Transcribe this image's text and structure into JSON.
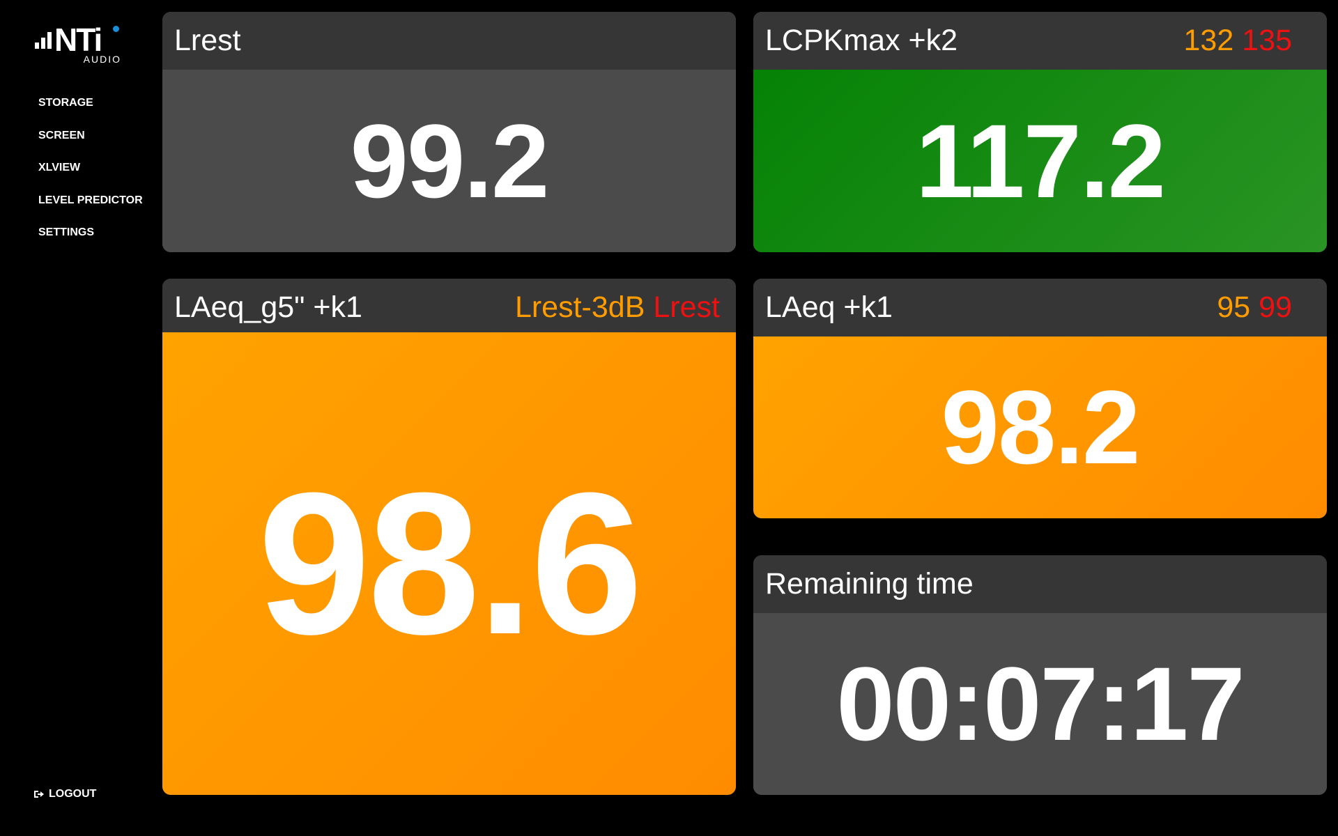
{
  "logo": {
    "main": "NTi",
    "sub": "AUDIO"
  },
  "nav": {
    "items": [
      {
        "label": "STORAGE"
      },
      {
        "label": "SCREEN"
      },
      {
        "label": "XLVIEW"
      },
      {
        "label": "LEVEL PREDICTOR"
      },
      {
        "label": "SETTINGS"
      }
    ],
    "logout_label": "LOGOUT"
  },
  "panels": {
    "lrest": {
      "title": "Lrest",
      "value": "99.2"
    },
    "lcpkmax": {
      "title": "LCPKmax +k2",
      "limit_warn": "132",
      "limit_alarm": "135",
      "value": "117.2"
    },
    "laeq_g5": {
      "title": "LAeq_g5\" +k1",
      "limit_warn": "Lrest-3dB",
      "limit_alarm": "Lrest",
      "value": "98.6"
    },
    "laeq": {
      "title": "LAeq +k1",
      "limit_warn": "95",
      "limit_alarm": "99",
      "value": "98.2"
    },
    "remaining": {
      "title": "Remaining time",
      "value": "00:07:17"
    }
  },
  "colors": {
    "background": "#000000",
    "header": "#363636",
    "neutral": "#4b4b4b",
    "ok_green": "#058205",
    "warning_orange": "#ff9800",
    "limit_warn_text": "#ff9c00",
    "limit_alarm_text": "#ee1111"
  }
}
